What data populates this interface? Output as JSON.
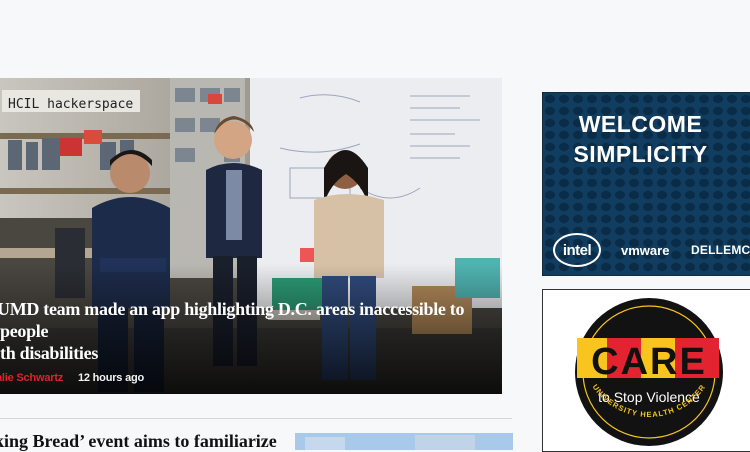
{
  "hero": {
    "headline": "UMD team made an app highlighting D.C. areas inaccessible to people\nth disabilities",
    "author": "alie Schwartz",
    "timestamp": "12 hours ago",
    "photo_sign_text": "HCIL hackerspace"
  },
  "second_story": {
    "headline": "king Bread’ event aims to familiarize"
  },
  "ads": {
    "welcome": {
      "headline_line1": "WELCOME",
      "headline_line2": "SIMPLICITY",
      "logo_intel": "intel",
      "logo_vmware": "vmware",
      "logo_dell": "DELLEMC"
    },
    "care": {
      "care_word": "CARE",
      "subtitle": "to Stop Violence",
      "ring_text": "UNIVERSITY HEALTH CENTER"
    }
  },
  "colors": {
    "accent_red": "#e2202b",
    "ad_navy": "#0f3656",
    "care_red": "#e32330",
    "care_yellow": "#f7c51e"
  }
}
